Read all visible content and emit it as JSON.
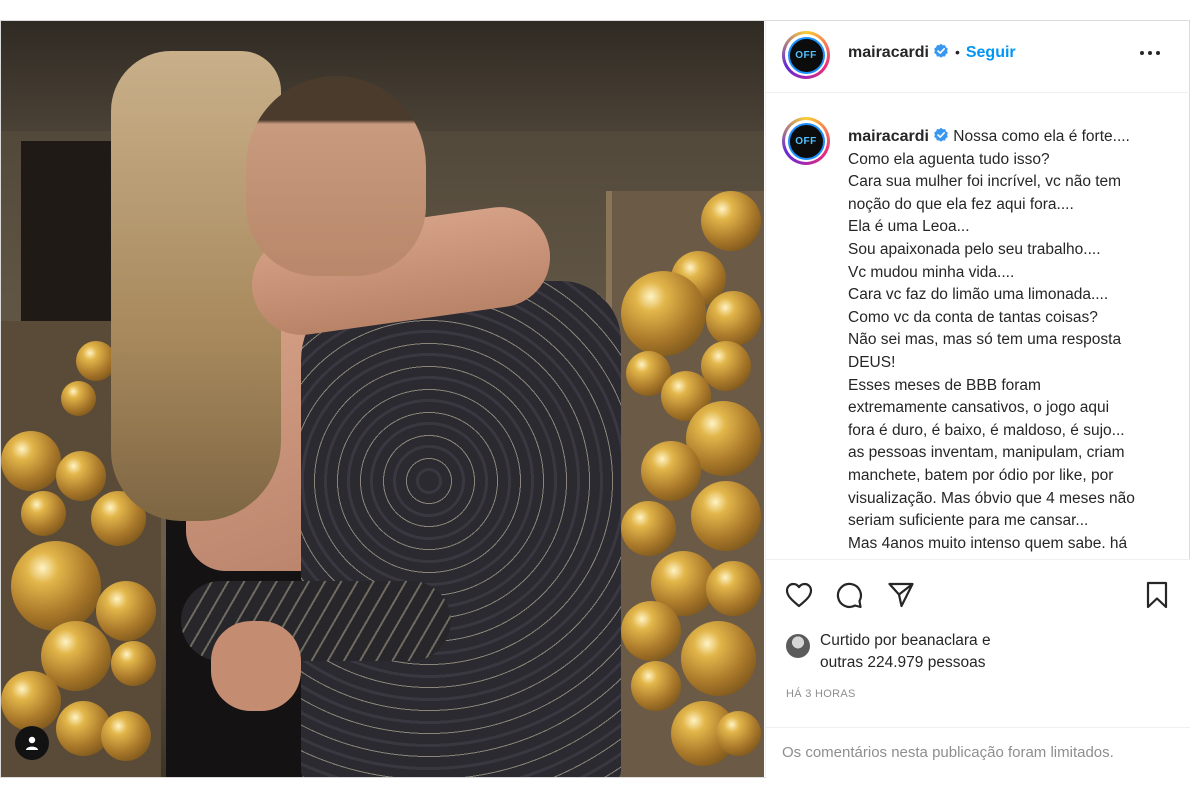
{
  "post": {
    "username": "mairacardi",
    "follow_label": "Seguir",
    "dot": "•",
    "avatar_text": "OFF"
  },
  "caption": {
    "username": "mairacardi",
    "lines": [
      "Nossa como ela é forte....",
      "Como ela aguenta tudo isso?",
      "Cara sua mulher foi incrível, vc não tem",
      "noção do que ela fez aqui fora....",
      "Ela é uma Leoa...",
      "Sou apaixonada pelo seu trabalho....",
      "Vc mudou minha vida....",
      "Cara vc faz do limão uma limonada....",
      "Como vc da conta de tantas coisas?",
      "Não sei mas, mas só tem uma resposta",
      "DEUS!",
      "Esses meses de BBB foram",
      "extremamente cansativos, o jogo aqui",
      "fora é duro, é baixo, é maldoso, é sujo...",
      "as pessoas inventam, manipulam, criam",
      "manchete, batem por ódio por like, por",
      "visualização. Mas óbvio que 4 meses não",
      "seriam suficiente para me cansar...",
      "Mas 4anos muito intenso quem sabe. há"
    ]
  },
  "likes": {
    "line1": "Curtido por beanaclara e",
    "line2": "outras 224.979 pessoas"
  },
  "time": "HÁ 3 HORAS",
  "comments_limited": "Os comentários nesta publicação foram limitados.",
  "colors": {
    "follow": "#0095f6",
    "verified": "#3897f0",
    "text": "#262626",
    "muted": "#8e8e8e",
    "border": "#dbdbdb"
  }
}
